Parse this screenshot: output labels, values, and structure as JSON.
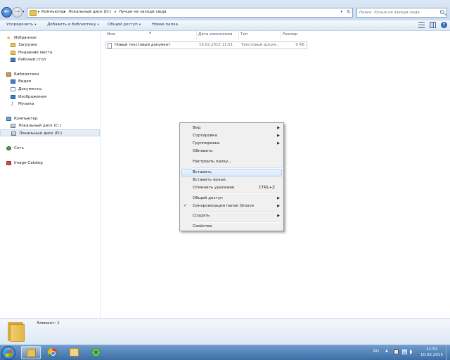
{
  "address": {
    "crumbs": [
      "Компьютер",
      "Локальный диск (D:)",
      "Лучше не заходи сюда"
    ],
    "search_placeholder": "Поиск: Лучше не заходи сюда"
  },
  "toolbar": {
    "organize": "Упорядочить",
    "add_to_library": "Добавить в библиотеку",
    "share": "Общий доступ",
    "new_folder": "Новая папка"
  },
  "nav": {
    "favorites": "Избранное",
    "downloads": "Загрузки",
    "recent": "Недавние места",
    "desktop": "Рабочий стол",
    "libraries": "Библиотеки",
    "video": "Видео",
    "documents": "Документы",
    "pictures": "Изображения",
    "music": "Музыка",
    "computer": "Компьютер",
    "drive_c": "Локальный диск (C:)",
    "drive_d": "Локальный диск (D:)",
    "network": "Сеть",
    "image_catalog": "Image Catalog"
  },
  "columns": {
    "name": "Имя",
    "date": "Дата изменения",
    "type": "Тип",
    "size": "Размер"
  },
  "files": [
    {
      "name": "Новый текстовый документ",
      "date": "10.02.2015 11:51",
      "type": "Текстовый докум...",
      "size": "0 КБ"
    }
  ],
  "context_menu": {
    "view": "Вид",
    "sort": "Сортировка",
    "group": "Группировка",
    "refresh": "Обновить",
    "customize": "Настроить папку...",
    "paste": "Вставить",
    "paste_shortcut": "Вставить ярлык",
    "undo_delete": "Отменить удаление",
    "undo_shortcut": "CTRL+Z",
    "share": "Общий доступ",
    "groove_sync": "Синхронизация папок Groove",
    "new": "Создать",
    "properties": "Свойства"
  },
  "details": {
    "count": "Элемент: 1"
  },
  "taskbar": {
    "lang": "RU",
    "time": "11:52",
    "date": "10.02.2015"
  }
}
